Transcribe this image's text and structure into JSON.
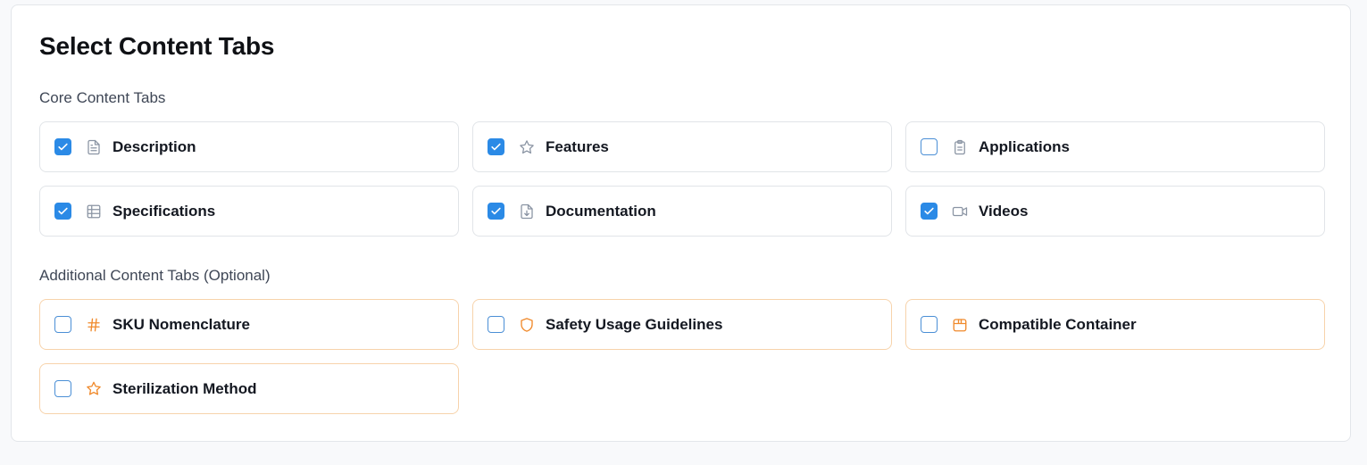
{
  "page_title": "Select Content Tabs",
  "core": {
    "heading": "Core Content Tabs",
    "items": [
      {
        "label": "Description",
        "checked": true,
        "icon": "document-icon"
      },
      {
        "label": "Features",
        "checked": true,
        "icon": "star-icon"
      },
      {
        "label": "Applications",
        "checked": false,
        "icon": "clipboard-icon"
      },
      {
        "label": "Specifications",
        "checked": true,
        "icon": "table-icon"
      },
      {
        "label": "Documentation",
        "checked": true,
        "icon": "file-download-icon"
      },
      {
        "label": "Videos",
        "checked": true,
        "icon": "video-icon"
      }
    ]
  },
  "additional": {
    "heading": "Additional Content Tabs (Optional)",
    "items": [
      {
        "label": "SKU Nomenclature",
        "checked": false,
        "icon": "hash-icon"
      },
      {
        "label": "Safety Usage Guidelines",
        "checked": false,
        "icon": "shield-icon"
      },
      {
        "label": "Compatible Container",
        "checked": false,
        "icon": "container-icon"
      },
      {
        "label": "Sterilization Method",
        "checked": false,
        "icon": "star-icon"
      }
    ]
  },
  "colors": {
    "checkbox_checked": "#2b8ae6",
    "core_icon": "#8a94a3",
    "additional_icon": "#f08a2c",
    "additional_border": "#f7d3ab"
  }
}
